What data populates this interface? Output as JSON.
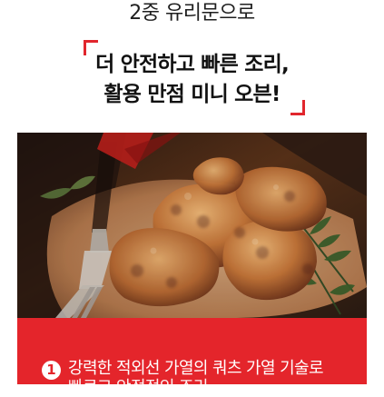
{
  "header": {
    "subtitle": "2중 유리문으로"
  },
  "headline": {
    "line1": "더 안전하고 빠른 조리,",
    "line2": "활용 만점 미니 오븐!"
  },
  "feature": {
    "number": "1",
    "text_line1": "강력한 적외선 가열의 쿼츠 가열 기술로",
    "text_line2": "빠르고 안정적인 조리"
  },
  "colors": {
    "accent": "#e4252b",
    "text": "#111111",
    "photo_bg": "#4a2b1a"
  }
}
